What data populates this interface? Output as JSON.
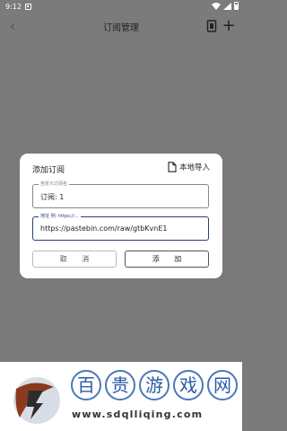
{
  "status_bar": {
    "time": "9:12"
  },
  "app_bar": {
    "title": "订阅管理",
    "back_glyph": "‹",
    "add_glyph": "+"
  },
  "dialog": {
    "title": "添加订阅",
    "local_import_label": "本地导入",
    "name_field": {
      "label": "自定义订阅名",
      "value": "订阅: 1"
    },
    "url_field": {
      "label": "地址 例: https://...",
      "value": "https://pastebin.com/raw/gtbKvnE1"
    },
    "cancel_label": "取 消",
    "confirm_label": "添 加"
  },
  "watermark": {
    "chars": [
      "百",
      "贵",
      "游",
      "戏",
      "网"
    ],
    "url": "www.sdqlliqing.com"
  },
  "colors": {
    "accent": "#2b3f72",
    "scrim": "#7a7a7a",
    "watermark_blue": "#2a5aa6"
  },
  "icons": [
    "back-icon",
    "import-file-icon",
    "add-icon",
    "document-icon",
    "wifi-icon",
    "signal-icon",
    "battery-icon"
  ]
}
